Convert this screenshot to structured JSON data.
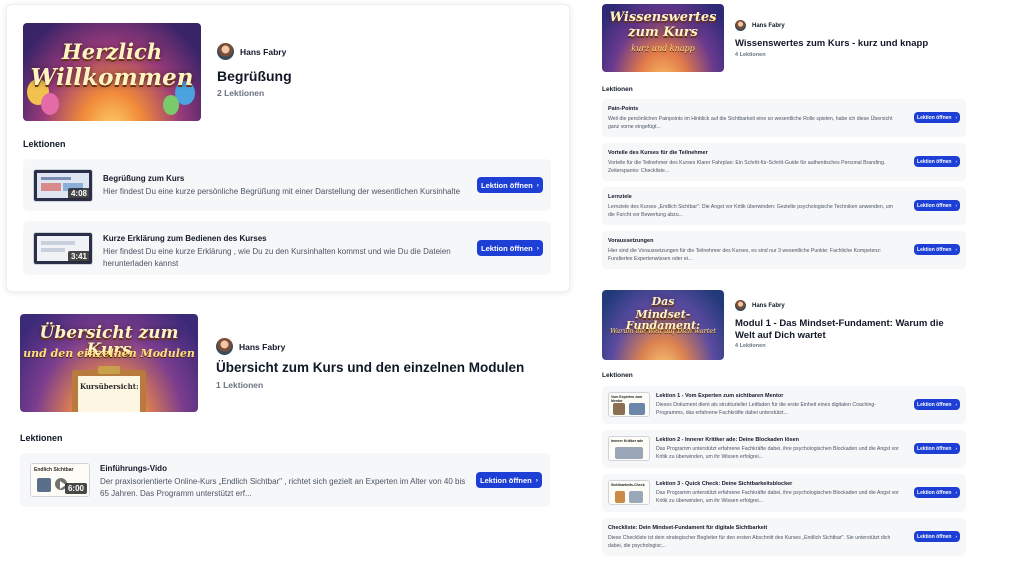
{
  "author": "Hans Fabry",
  "lessons_heading": "Lektionen",
  "open_button": "Lektion öffnen",
  "modules": {
    "welcome": {
      "thumb_title_1": "Herzlich",
      "thumb_title_2": "Willkommen",
      "title": "Begrüßung",
      "count": "2 Lektionen",
      "lessons": [
        {
          "title": "Begrüßung zum Kurs",
          "desc": "Hier findest Du eine kurze persönliche Begrüßung mit einer Darstellung der wesentlichen Kursinhalte",
          "duration": "4:08"
        },
        {
          "title": "Kurze Erklärung zum Bedienen des Kurses",
          "desc": "Hier findest Du eine kurze Erklärung , wie Du zu den Kursinhalten kommst und wie Du die Dateien herunterladen kannst",
          "duration": "3:41"
        }
      ]
    },
    "overview": {
      "thumb_title": "Übersicht zum Kurs",
      "thumb_sub": "und den einzelnen Modulen",
      "thumb_board": "Kursübersicht:",
      "title": "Übersicht zum Kurs und den einzelnen Modulen",
      "count": "1 Lektionen",
      "lessons": [
        {
          "title": "Einführungs-Vido",
          "desc": "Der praxisorientierte Online-Kurs „Endlich Sichtbar\" , richtet sich gezielt an Experten im Alter von 40 bis 65 Jahren. Das Programm unterstützt erf...",
          "duration": "6:00",
          "thumb_label": "Endlich Sichtbar"
        }
      ]
    },
    "facts": {
      "thumb_title_1": "Wissenswertes",
      "thumb_title_2": "zum Kurs",
      "thumb_sub": "kurz und knapp",
      "title": "Wissenswertes zum Kurs - kurz und knapp",
      "count": "4 Lektionen",
      "lessons": [
        {
          "title": "Pain-Points",
          "desc": "Weil die persönlichen Painpoints im Hinblick auf die Sichtbarkeit eine so wesentliche Rolle spielen, habe ich diese Übersicht ganz vorne eingefügt..."
        },
        {
          "title": "Vorteile des Kurses für die Teilnehmer",
          "desc": "Vorteile für die Teilnehmer des Kurses Klarer Fahrplan: Ein Schritt-für-Schritt-Guide für authentisches Personal Branding. Zeitersparnis: Checkliste..."
        },
        {
          "title": "Lernziele",
          "desc": "Lernziele des Kurses „Endlich Sichtbar\": Die Angst vor Kritik überwinden: Gezielte psychologische Techniken anwenden, um die Furcht vor Bewertung abzu..."
        },
        {
          "title": "Voraussetzungen",
          "desc": "Hier sind die Voraussetzungen für die Teilnehmer des Kurses, es sind nur 3 wesentliche Punkte: Fachliche Kompetenz: Fundiertes Expertenwissen oder ei..."
        }
      ]
    },
    "mindset": {
      "thumb_title_1": "Das",
      "thumb_title_2": "Mindset-Fundament:",
      "thumb_sub": "Warum die Welt auf Dich wartet",
      "title": "Modul 1 - Das Mindset-Fundament: Warum die Welt auf Dich wartet",
      "count": "4 Lektionen",
      "lessons": [
        {
          "title": "Lektion 1 - Vom Experten zum sichtbaren Mentor",
          "desc": "Dieses Dokument dient als strukturieller Leitfaden für die erste Einheit eines digitalen Coaching-Programms, das erfahrene Fachkräfte dabei unterstützt...",
          "has_thumb": true,
          "thumb_label": "Vom Experten zum Mentor"
        },
        {
          "title": "Lektion 2 - Innerer Kritiker ade: Deine Blockaden lösen",
          "desc": "Das Programm unterstützt erfahrene Fachkräfte dabei, ihre psychologischen Blockaden und die Angst vor Kritik zu überwinden, um ihr Wissen erfolgrei...",
          "has_thumb": true,
          "thumb_label": "Innerer Kritiker ade"
        },
        {
          "title": "Lektion 3 - Quick Check: Deine Sichtbarkeitsblocker",
          "desc": "Das Programm unterstützt erfahrene Fachkräfte dabei, ihre psychologischen Blockaden und die Angst vor Kritik zu überwinden, um ihr Wissen erfolgrei...",
          "has_thumb": true,
          "thumb_label": "Sichtbarkeits-Check"
        },
        {
          "title": "Checkliste: Dein Mindset-Fundament für digitale Sichtbarkeit",
          "desc": "Diese Checkliste ist dein strategischer Begleiter für den ersten Abschnitt des Kurses „Endlich Sichtbar\". Sie unterstützt dich dabei, die psychologisc...",
          "has_thumb": false
        }
      ]
    }
  },
  "colors": {
    "button": "#1d3fd6",
    "row_bg": "#f6f7f9",
    "thumb_purple": "#3a2b7a",
    "thumb_gold": "#f5b942"
  }
}
